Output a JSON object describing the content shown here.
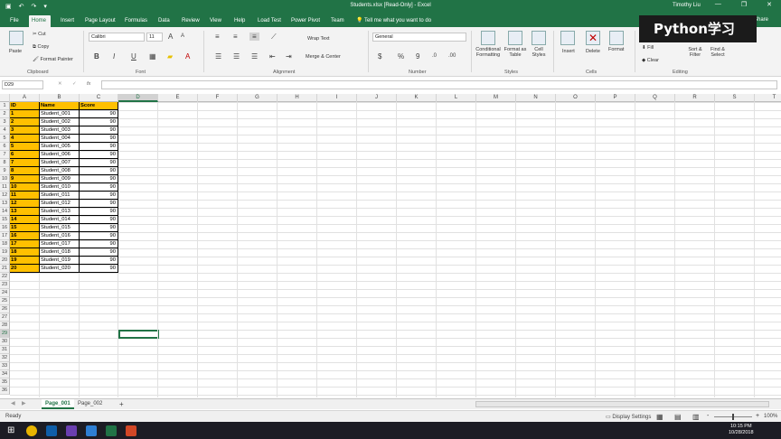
{
  "titlebar": {
    "title": "Students.xlsx [Read-Only] - Excel",
    "user": "Timothy Liu",
    "minimize": "—",
    "restore": "❐",
    "close": "✕"
  },
  "tabs": [
    {
      "label": "File"
    },
    {
      "label": "Home"
    },
    {
      "label": "Insert"
    },
    {
      "label": "Page Layout"
    },
    {
      "label": "Formulas"
    },
    {
      "label": "Data"
    },
    {
      "label": "Review"
    },
    {
      "label": "View"
    },
    {
      "label": "Help"
    },
    {
      "label": "Load Test"
    },
    {
      "label": "Power Pivot"
    },
    {
      "label": "Team"
    }
  ],
  "tell_me": "Tell me what you want to do",
  "share": "Share",
  "ribbon": {
    "paste": "Paste",
    "cut": "Cut",
    "copy": "Copy",
    "format_painter": "Format Painter",
    "clipboard": "Clipboard",
    "font_name": "Calibri",
    "font_size": "11",
    "font": "Font",
    "bold": "B",
    "italic": "I",
    "underline": "U",
    "wrap_text": "Wrap Text",
    "merge_center": "Merge & Center",
    "alignment": "Alignment",
    "number_format": "General",
    "currency": "$",
    "percent": "%",
    "comma": "9",
    "number": "Number",
    "conditional_formatting": "Conditional Formatting",
    "format_as_table": "Format as Table",
    "cell_styles": "Cell Styles",
    "styles": "Styles",
    "insert": "Insert",
    "delete": "Delete",
    "format": "Format",
    "cells": "Cells",
    "fill": "Fill",
    "clear": "Clear",
    "sort_filter": "Sort & Filter",
    "find_select": "Find & Select",
    "editing": "Editing"
  },
  "watermark": "Python学习",
  "formula_bar": {
    "name_box": "D29",
    "fx": "fx",
    "value": ""
  },
  "columns": [
    "A",
    "B",
    "C",
    "D",
    "E",
    "F",
    "G",
    "H",
    "I",
    "J",
    "K",
    "L",
    "M",
    "N",
    "O",
    "P",
    "Q",
    "R",
    "S",
    "T"
  ],
  "selected_column": "D",
  "selected_row": 29,
  "table": {
    "headers": [
      "ID",
      "Name",
      "Score"
    ],
    "rows": [
      [
        "1",
        "Student_001",
        "90"
      ],
      [
        "2",
        "Student_002",
        "90"
      ],
      [
        "3",
        "Student_003",
        "90"
      ],
      [
        "4",
        "Student_004",
        "90"
      ],
      [
        "5",
        "Student_005",
        "90"
      ],
      [
        "6",
        "Student_006",
        "90"
      ],
      [
        "7",
        "Student_007",
        "90"
      ],
      [
        "8",
        "Student_008",
        "90"
      ],
      [
        "9",
        "Student_009",
        "90"
      ],
      [
        "10",
        "Student_010",
        "90"
      ],
      [
        "11",
        "Student_011",
        "90"
      ],
      [
        "12",
        "Student_012",
        "90"
      ],
      [
        "13",
        "Student_013",
        "90"
      ],
      [
        "14",
        "Student_014",
        "90"
      ],
      [
        "15",
        "Student_015",
        "90"
      ],
      [
        "16",
        "Student_016",
        "90"
      ],
      [
        "17",
        "Student_017",
        "90"
      ],
      [
        "18",
        "Student_018",
        "90"
      ],
      [
        "19",
        "Student_019",
        "90"
      ],
      [
        "20",
        "Student_020",
        "90"
      ]
    ]
  },
  "row_count": 36,
  "sheets": [
    {
      "label": "Page_001",
      "active": true
    },
    {
      "label": "Page_002",
      "active": false
    }
  ],
  "add_sheet": "+",
  "status": {
    "ready": "Ready",
    "display_settings": "Display Settings",
    "zoom": "100%",
    "zoom_minus": "-",
    "zoom_plus": "+"
  },
  "taskbar": {
    "time": "10:15 PM",
    "date": "10/28/2018"
  },
  "colors": {
    "excel_green": "#217346",
    "header_fill": "#ffc000"
  }
}
